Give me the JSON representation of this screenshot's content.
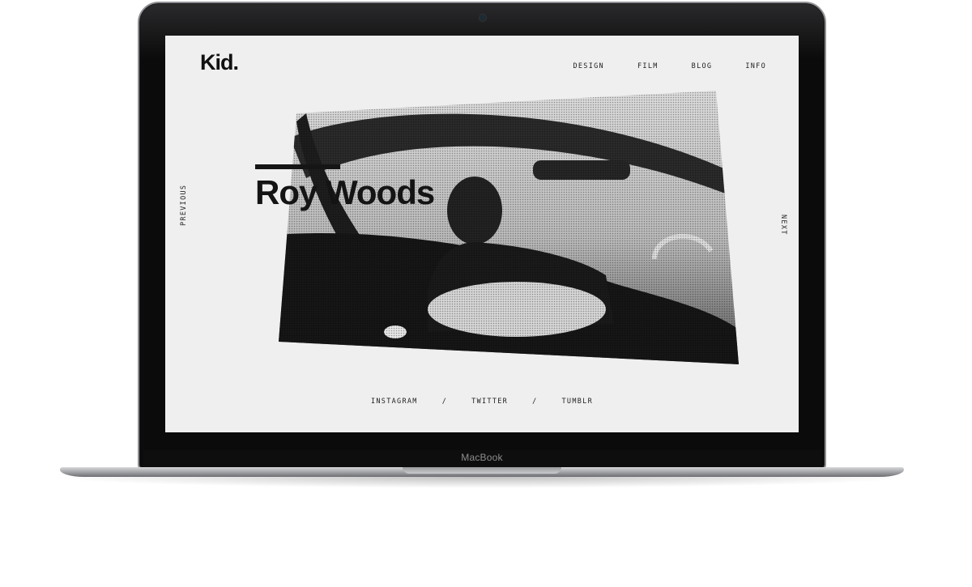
{
  "device": {
    "brand_label": "MacBook"
  },
  "site": {
    "logo": "Kid.",
    "nav": [
      {
        "label": "DESIGN"
      },
      {
        "label": "FILM"
      },
      {
        "label": "BLOG"
      },
      {
        "label": "INFO"
      }
    ],
    "feature_title": "Roy Woods",
    "previous_label": "PREVIOUS",
    "next_label": "NEXT",
    "social": {
      "items": [
        {
          "label": "INSTAGRAM"
        },
        {
          "label": "TWITTER"
        },
        {
          "label": "TUMBLR"
        }
      ],
      "separator": "/"
    }
  },
  "colors": {
    "screen_bg": "#efefef",
    "text": "#141414",
    "frame": "#0b0b0c"
  }
}
